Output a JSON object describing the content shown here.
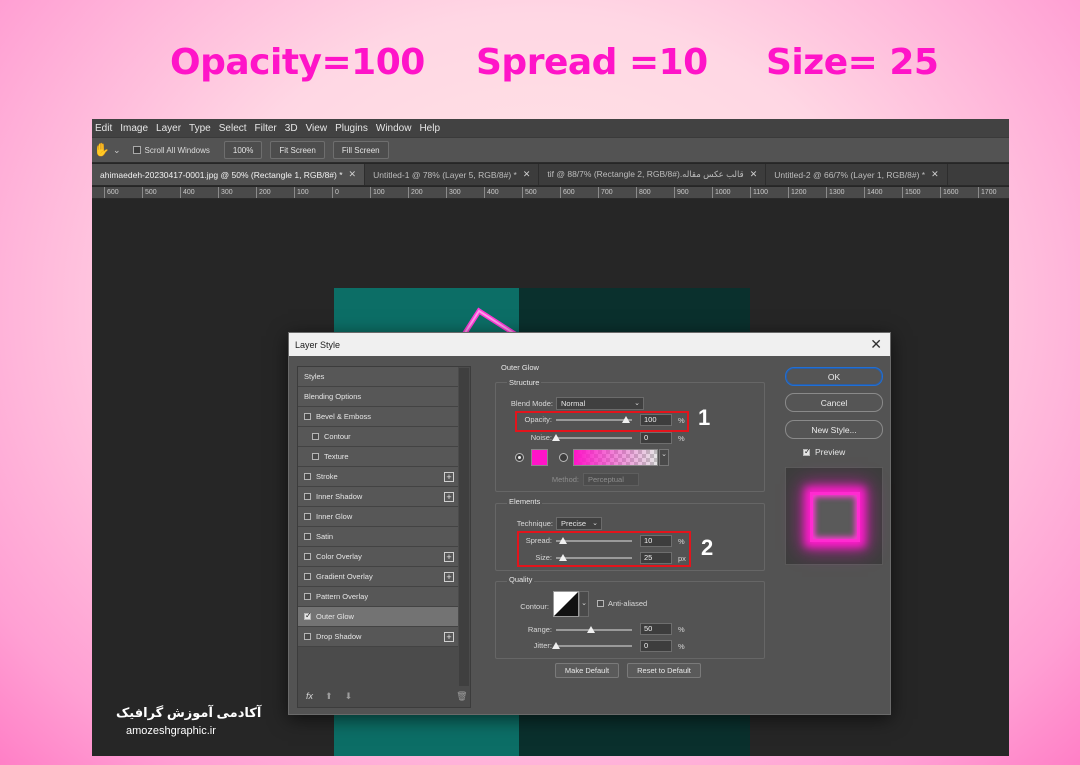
{
  "captions": {
    "opacity": "Opacity=100",
    "spread": "Spread =10",
    "size": "Size= 25"
  },
  "menubar": [
    "Edit",
    "Image",
    "Layer",
    "Type",
    "Select",
    "Filter",
    "3D",
    "View",
    "Plugins",
    "Window",
    "Help"
  ],
  "options_bar": {
    "scroll_all_windows": "Scroll All Windows",
    "zoom_100": "100%",
    "fit_screen": "Fit Screen",
    "fill_screen": "Fill Screen"
  },
  "tabs": [
    "ahimaedeh-20230417-0001.jpg @ 50% (Rectangle 1, RGB/8#) *",
    "Untitled-1 @ 78% (Layer 5, RGB/8#) *",
    "قالب عکس مقاله.tif @ 88/7% (Rectangle 2, RGB/8#)",
    "Untitled-2 @ 66/7% (Layer 1, RGB/8#) *"
  ],
  "ruler_ticks": [
    "600",
    "500",
    "400",
    "300",
    "200",
    "100",
    "0",
    "100",
    "200",
    "300",
    "400",
    "500",
    "600",
    "700",
    "800",
    "900",
    "1000",
    "1100",
    "1200",
    "1300",
    "1400",
    "1500",
    "1600",
    "1700"
  ],
  "dialog": {
    "title": "Layer Style",
    "left_list": {
      "styles": "Styles",
      "blending_options": "Blending Options",
      "bevel_emboss": "Bevel & Emboss",
      "contour": "Contour",
      "texture": "Texture",
      "stroke": "Stroke",
      "inner_shadow": "Inner Shadow",
      "inner_glow": "Inner Glow",
      "satin": "Satin",
      "color_overlay": "Color Overlay",
      "gradient_overlay": "Gradient Overlay",
      "pattern_overlay": "Pattern Overlay",
      "outer_glow": "Outer Glow",
      "drop_shadow": "Drop Shadow",
      "fx": "fx"
    },
    "outer_glow": {
      "section": "Outer Glow",
      "structure": "Structure",
      "blend_mode_label": "Blend Mode:",
      "blend_mode": "Normal",
      "opacity_label": "Opacity:",
      "opacity": "100",
      "opacity_level": 100,
      "noise_label": "Noise:",
      "noise": "0",
      "noise_level": 0,
      "percent": "%",
      "px": "px",
      "glow_color": "#ff14c8",
      "method_label": "Method:",
      "method": "Perceptual",
      "elements": "Elements",
      "technique_label": "Technique:",
      "technique": "Precise",
      "spread_label": "Spread:",
      "spread": "10",
      "spread_level": 10,
      "size_label": "Size:",
      "size": "25",
      "size_level": 25,
      "quality": "Quality",
      "contour_label": "Contour:",
      "anti_aliased": "Anti-aliased",
      "range_label": "Range:",
      "range": "50",
      "range_level": 50,
      "jitter_label": "Jitter:",
      "jitter": "0",
      "jitter_level": 0,
      "make_default": "Make Default",
      "reset_default": "Reset to Default"
    },
    "buttons": {
      "ok": "OK",
      "cancel": "Cancel",
      "new_style": "New Style...",
      "preview": "Preview"
    },
    "markers": [
      "1",
      "2"
    ]
  },
  "watermark": {
    "persian": "آکادمی آموزش گرافیک",
    "site": "amozeshgraphic.ir"
  }
}
